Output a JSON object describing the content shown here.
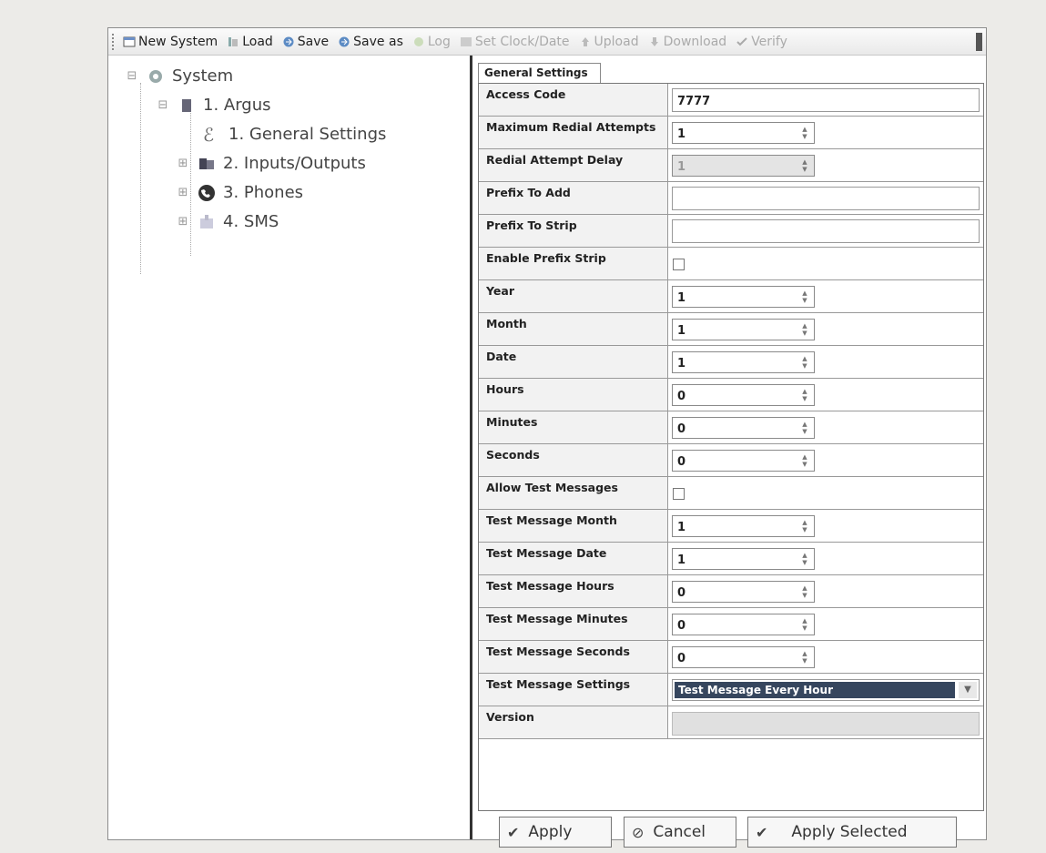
{
  "toolbar": {
    "new_system": "New System",
    "load": "Load",
    "save": "Save",
    "save_as": "Save as",
    "log": "Log",
    "set_clock": "Set Clock/Date",
    "upload": "Upload",
    "download": "Download",
    "verify": "Verify"
  },
  "tree": {
    "root": "System",
    "device": "1. Argus",
    "items": [
      "1. General Settings",
      "2. Inputs/Outputs",
      "3. Phones",
      "4. SMS"
    ]
  },
  "tab": {
    "label": "General Settings"
  },
  "settings": {
    "access_code": {
      "label": "Access Code",
      "value": "7777"
    },
    "max_redial": {
      "label": "Maximum Redial Attempts",
      "value": "1"
    },
    "redial_delay": {
      "label": "Redial Attempt Delay",
      "value": "1"
    },
    "prefix_add": {
      "label": "Prefix To Add",
      "value": ""
    },
    "prefix_strip": {
      "label": "Prefix To Strip",
      "value": ""
    },
    "enable_prefix_strip": {
      "label": "Enable Prefix Strip",
      "checked": false
    },
    "year": {
      "label": "Year",
      "value": "1"
    },
    "month": {
      "label": "Month",
      "value": "1"
    },
    "date": {
      "label": "Date",
      "value": "1"
    },
    "hours": {
      "label": "Hours",
      "value": "0"
    },
    "minutes": {
      "label": "Minutes",
      "value": "0"
    },
    "seconds": {
      "label": "Seconds",
      "value": "0"
    },
    "allow_test": {
      "label": "Allow Test Messages",
      "checked": false
    },
    "test_month": {
      "label": "Test Message Month",
      "value": "1"
    },
    "test_date": {
      "label": "Test Message Date",
      "value": "1"
    },
    "test_hours": {
      "label": "Test Message Hours",
      "value": "0"
    },
    "test_minutes": {
      "label": "Test Message Minutes",
      "value": "0"
    },
    "test_seconds": {
      "label": "Test Message Seconds",
      "value": "0"
    },
    "test_settings": {
      "label": "Test Message Settings",
      "value": "Test Message Every Hour"
    },
    "version": {
      "label": "Version",
      "value": ""
    }
  },
  "buttons": {
    "apply": "Apply",
    "cancel": "Cancel",
    "apply_selected": "Apply Selected"
  }
}
